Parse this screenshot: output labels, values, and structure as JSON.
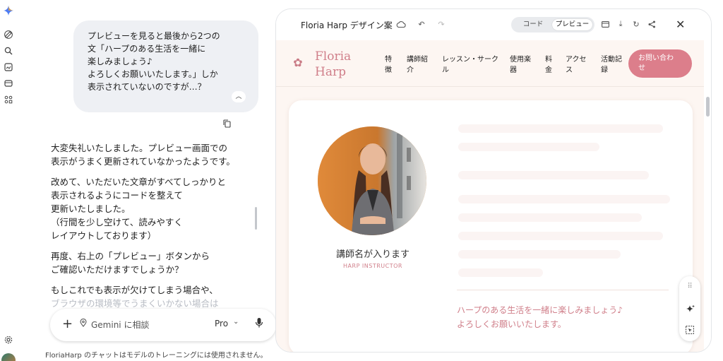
{
  "chat": {
    "user_message": "プレビューを見ると最後から2つの\n文「ハープのある生活を一緒に\n楽しみましょう♪\nよろしくお願いいたします。」しか\n表示されていないのですが…？",
    "reply_paragraphs": [
      "大変失礼いたしました。プレビュー画面での\n表示がうまく更新されていなかったようです。",
      "改めて、いただいた文章がすべてしっかりと\n表示されるようにコードを整えて\n更新いたしました。\n（行間を少し空けて、読みやすく\nレイアウトしております）",
      "再度、右上の「プレビュー」ボタンから\nご確認いただけますでしょうか？"
    ],
    "reply_last_line1": "もしこれでも表示が欠けてしまう場合や、",
    "reply_last_line2": "ブラウザの環境等でうまくいかない場合は",
    "input_placeholder": "Gemini に相談",
    "mode_label": "Pro",
    "disclaimer": "FloriaHarp のチャットはモデルのトレーニングには使用されません。"
  },
  "panel": {
    "title": "Floria Harp デザイン案",
    "toggle_code": "コード",
    "toggle_preview": "プレビュー"
  },
  "site": {
    "logo_line1": "Floria",
    "logo_line2": "Harp",
    "nav": [
      "特\n徴",
      "講師紹\n介",
      "レッスン・サーク\nル",
      "使用楽\n器",
      "料\n金",
      "アクセ\nス",
      "活動記\n録"
    ],
    "contact": "お問い合わ\nせ",
    "instructor_name": "講師名が入ります",
    "instructor_role": "HARP INSTRUCTOR",
    "message": "ハープのある生活を一緒に楽しみましょう♪\nよろしくお願いいたします。"
  },
  "colors": {
    "accent": "#d07f8a",
    "button": "#dc7e8b",
    "page_bg": "#fdf6f2"
  }
}
